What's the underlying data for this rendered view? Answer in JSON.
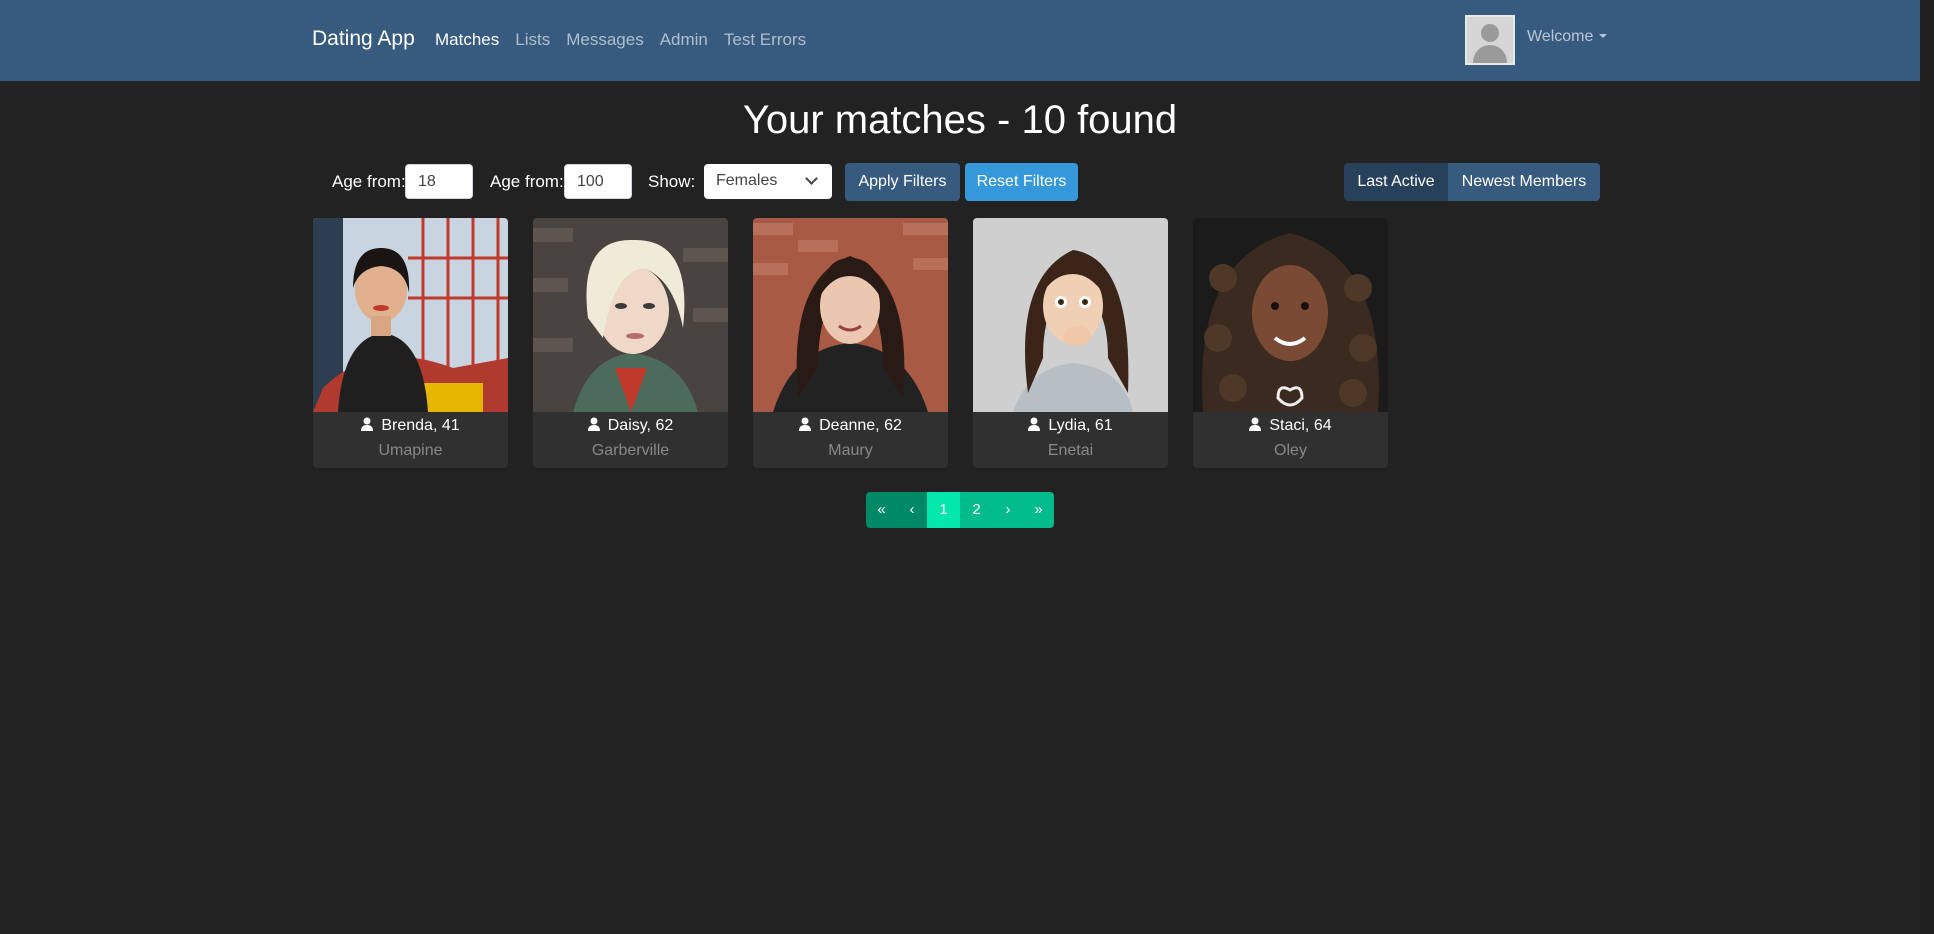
{
  "navbar": {
    "brand": "Dating App",
    "links": [
      "Matches",
      "Lists",
      "Messages",
      "Admin",
      "Test Errors"
    ],
    "welcome": "Welcome"
  },
  "page": {
    "title": "Your matches - 10 found"
  },
  "filters": {
    "age_from_label": "Age from:",
    "age_from_value": "18",
    "age_to_label": "Age from:",
    "age_to_value": "100",
    "show_label": "Show:",
    "show_value": "Females",
    "apply_label": "Apply Filters",
    "reset_label": "Reset Filters",
    "sort_last_active": "Last Active",
    "sort_newest": "Newest Members"
  },
  "members": [
    {
      "title": "Brenda, 41",
      "city": "Umapine"
    },
    {
      "title": "Daisy, 62",
      "city": "Garberville"
    },
    {
      "title": "Deanne, 62",
      "city": "Maury"
    },
    {
      "title": "Lydia, 61",
      "city": "Enetai"
    },
    {
      "title": "Staci, 64",
      "city": "Oley"
    }
  ],
  "pagination": {
    "first": "«",
    "prev": "‹",
    "pages": [
      "1",
      "2"
    ],
    "current_page": 1,
    "next": "›",
    "last": "»"
  },
  "colors": {
    "navbar": "#375a7f",
    "background": "#222222",
    "card": "#303030",
    "accent_teal": "#00bc8c",
    "info_blue": "#3498db"
  }
}
